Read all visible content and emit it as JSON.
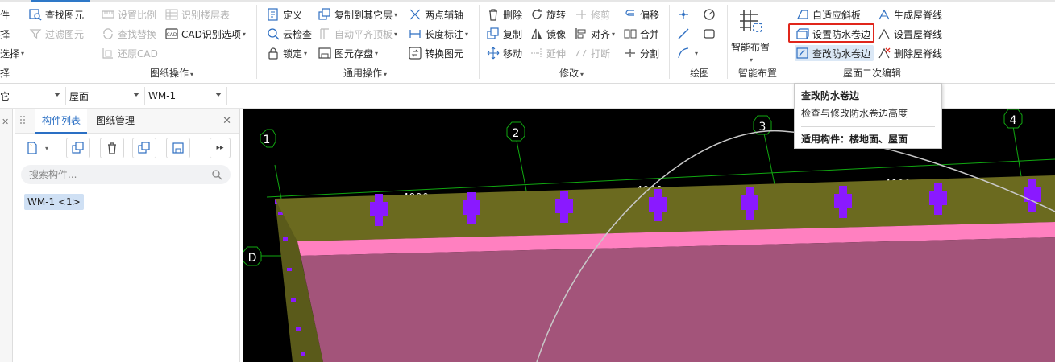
{
  "ribbon": {
    "col0": [
      "件",
      "择",
      "选择",
      "择"
    ],
    "col1": {
      "find_element": "查找图元",
      "filter_element": "过滤图元"
    },
    "drawing_ops": {
      "set_scale": "设置比例",
      "recognize_floors": "识别楼层表",
      "find_replace": "查找替换",
      "cad_options": "CAD识别选项",
      "restore_cad": "还原CAD",
      "group_label": "图纸操作"
    },
    "common_ops": {
      "define": "定义",
      "copy_to_floor": "复制到其它层",
      "two_point_axis": "两点辅轴",
      "cloud_check": "云检查",
      "auto_level": "自动平齐顶板",
      "length_dim": "长度标注",
      "lock": "锁定",
      "element_store": "图元存盘",
      "convert_element": "转换图元",
      "group_label": "通用操作"
    },
    "modify": {
      "delete": "删除",
      "rotate": "旋转",
      "trim": "修剪",
      "offset": "偏移",
      "copy": "复制",
      "mirror": "镜像",
      "align": "对齐",
      "merge": "合并",
      "move": "移动",
      "extend": "延伸",
      "break": "打断",
      "split": "分割",
      "group_label": "修改"
    },
    "draw": {
      "group_label": "绘图"
    },
    "smart_layout": {
      "label": "智能布置",
      "group_label": "智能布置"
    },
    "roof_edit": {
      "adaptive_slope": "自适应斜板",
      "gen_ridge": "生成屋脊线",
      "set_waterproof": "设置防水卷边",
      "set_ridge": "设置屋脊线",
      "edit_waterproof": "查改防水卷边",
      "delete_ridge": "删除屋脊线",
      "group_label": "屋面二次编辑"
    }
  },
  "tooltip": {
    "title": "查改防水卷边",
    "desc": "检查与修改防水卷边高度",
    "usage": "适用构件：楼地面、屋面"
  },
  "filterbar": {
    "combo0": "它",
    "combo1": "屋面",
    "combo2": "WM-1"
  },
  "panel": {
    "tab_components": "构件列表",
    "tab_drawings": "图纸管理",
    "search_placeholder": "搜索构件...",
    "item": "WM-1 <1>"
  },
  "viewport": {
    "axis_labels": [
      "1",
      "2",
      "3",
      "4",
      "D"
    ],
    "dims": [
      "4000",
      "4000",
      "4000"
    ]
  },
  "colors": {
    "accent": "#2a6fc4",
    "highlight": "#e0261b",
    "slab_top": "#6b6a1f",
    "slab_pink": "#ff80c0",
    "slab_body": "#a3547a",
    "rebar_purple": "#8a19ff"
  }
}
